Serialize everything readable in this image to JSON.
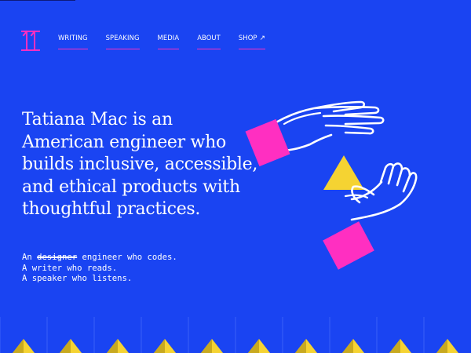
{
  "nav": {
    "items": [
      {
        "label": "WRITING"
      },
      {
        "label": "SPEAKING"
      },
      {
        "label": "MEDIA"
      },
      {
        "label": "ABOUT"
      },
      {
        "label": "SHOP",
        "icon": "external-arrow-icon",
        "glyph": "↗"
      }
    ]
  },
  "hero": {
    "headline": "Tatiana Mac is an American engineer who builds inclusive, accessible, and ethical products with thoughtful practices.",
    "tagline": {
      "line1_prefix": "An ",
      "line1_struck": "designer",
      "line1_suffix": " engineer who codes.",
      "line2": "A writer who reads.",
      "line3": "A speaker who listens."
    }
  },
  "colors": {
    "background": "#1a44f2",
    "accent_pink": "#ff2fc1",
    "accent_yellow": "#f5d332",
    "text": "#ffffff"
  },
  "icons": {
    "logo": "tm-monogram-logo",
    "illustration": "hands-triangle-illustration"
  }
}
